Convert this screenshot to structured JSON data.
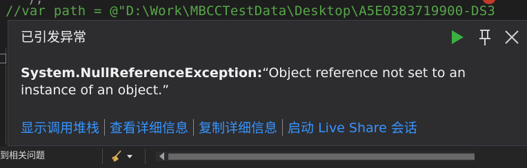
{
  "editor": {
    "code_line": "//var path = @\"D:\\Work\\MBCCTestData\\Desktop\\A5E0383719900-DS3",
    "code_line_above": "                                                  ),"
  },
  "exception_popup": {
    "title": "已引发异常",
    "exception_type": "System.NullReferenceException:",
    "exception_message": "“Object reference not set to an instance of an object.”",
    "links": {
      "call_stack": "显示调用堆栈",
      "view_details": "查看详细信息",
      "copy_details": "复制详细信息",
      "live_share": "启动 Live Share 会话"
    },
    "icons": {
      "continue": "play-icon",
      "pin": "pin-icon",
      "close": "close-icon"
    }
  },
  "bottom_bar": {
    "issues_text": "到相关问题",
    "icons": {
      "broom": "broom-icon",
      "dropdown": "dropdown-arrow-icon"
    }
  },
  "colors": {
    "popup_bg": "#2d2d30",
    "link": "#3794ff",
    "continue_green": "#3cb043",
    "comment_green": "#57a64a"
  }
}
